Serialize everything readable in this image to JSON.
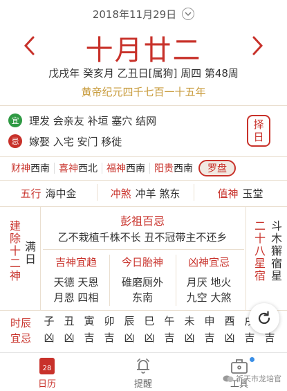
{
  "header": {
    "date": "2018年11月29日",
    "dropdown_icon": "chevron-down-icon",
    "lunar_date": "十月廿二",
    "ganzhi": "戊戌年 癸亥月 乙丑日[属狗] 周四 第48周",
    "huangdi": "黄帝纪元四千七百一十五年",
    "prev_icon": "chevron-left-icon",
    "next_icon": "chevron-right-icon"
  },
  "yiji": {
    "yi_badge": "宜",
    "yi_text": "理发 会亲友 补垣 塞穴 结网",
    "ji_badge": "忌",
    "ji_text": "嫁娶 入宅 安门 移徙",
    "zeri_label_1": "择",
    "zeri_label_2": "日"
  },
  "gods": [
    {
      "k": "财神",
      "v": "西南"
    },
    {
      "k": "喜神",
      "v": "西北"
    },
    {
      "k": "福神",
      "v": "西南"
    },
    {
      "k": "阳贵",
      "v": "西南"
    }
  ],
  "luopan": "罗盘",
  "row3": {
    "wuxing_k": "五行",
    "wuxing_v": "海中金",
    "chongsha_k": "冲煞",
    "chongsha_v": "冲羊 煞东",
    "zhishen_k": "值神",
    "zhishen_v": "玉堂"
  },
  "left_side": {
    "title": "建除十二神",
    "value": "满日"
  },
  "right_side": {
    "title": "二十八星宿",
    "value": "斗木獬宿星"
  },
  "pengzu": {
    "title": "彭祖百忌",
    "text": "乙不栽植千株不长 丑不冠带主不还乡"
  },
  "sub": [
    {
      "title": "吉神宜趋",
      "line1": "天德 天恩",
      "line2": "月恩 四相"
    },
    {
      "title": "今日胎神",
      "line1": "碓磨厕外",
      "line2": "东南"
    },
    {
      "title": "凶神宜忌",
      "line1": "月厌 地火",
      "line2": "九空 大煞"
    }
  ],
  "shichen": {
    "label_1": "时辰",
    "label_2": "宜忌",
    "branches": [
      "子",
      "丑",
      "寅",
      "卯",
      "辰",
      "巳",
      "午",
      "未",
      "申",
      "酉",
      "戌",
      "亥"
    ],
    "luck": [
      "凶",
      "凶",
      "吉",
      "吉",
      "凶",
      "凶",
      "吉",
      "凶",
      "吉",
      "凶",
      "吉",
      "吉"
    ]
  },
  "refresh_icon": "refresh-icon",
  "tabs": [
    {
      "label": "日历",
      "icon": "calendar-icon",
      "day": "28"
    },
    {
      "label": "提醒",
      "icon": "bell-icon"
    },
    {
      "label": "工具",
      "icon": "toolbox-icon"
    }
  ],
  "watermark": "祈天市龙培官"
}
